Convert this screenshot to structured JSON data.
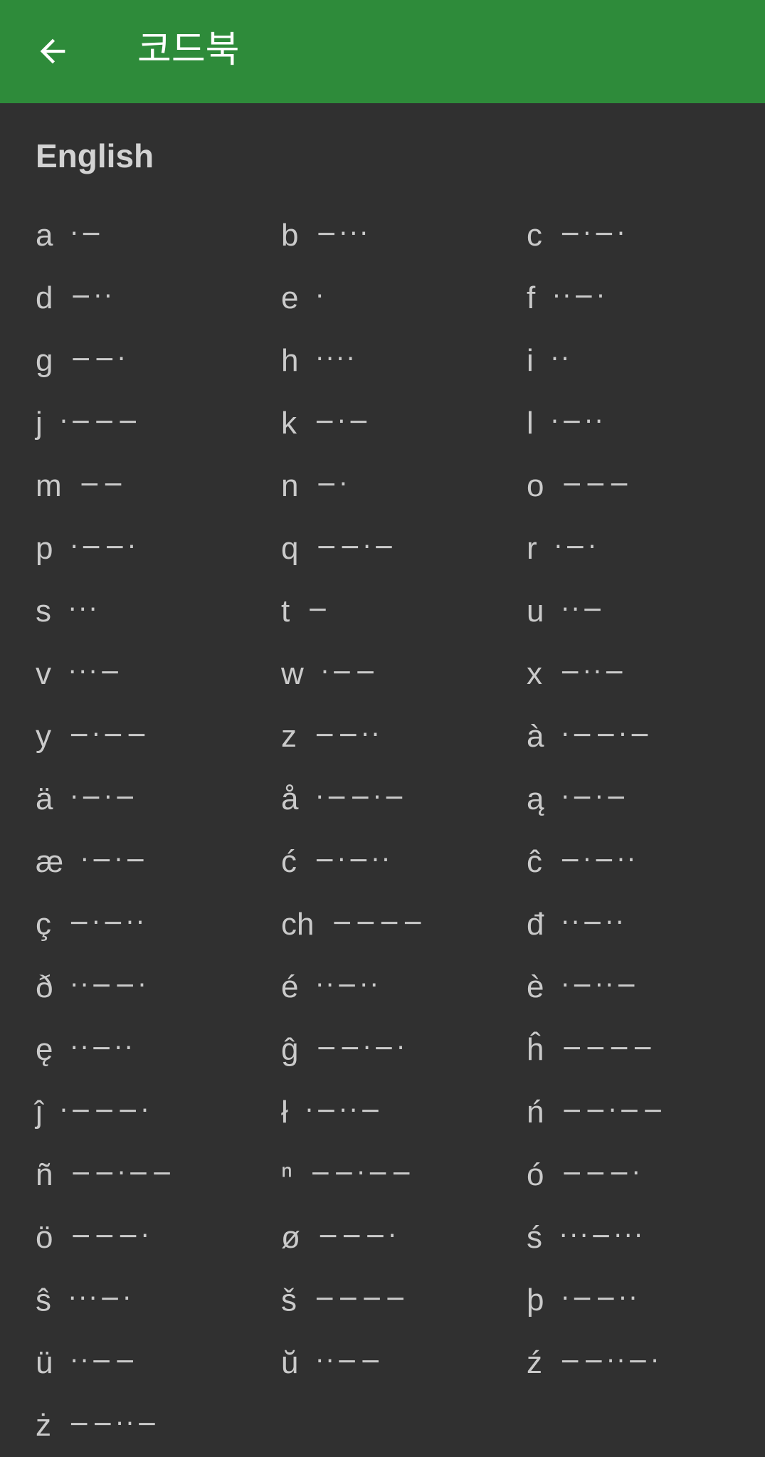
{
  "appbar": {
    "title": "코드북",
    "back_icon": "arrow-left-icon",
    "color": "#2e8b3a"
  },
  "section": {
    "title": "English"
  },
  "codes": [
    {
      "letter": "a",
      "code": "·−"
    },
    {
      "letter": "b",
      "code": "−···"
    },
    {
      "letter": "c",
      "code": "−·−·"
    },
    {
      "letter": "d",
      "code": "−··"
    },
    {
      "letter": "e",
      "code": "·"
    },
    {
      "letter": "f",
      "code": "··−·"
    },
    {
      "letter": "g",
      "code": "−−·"
    },
    {
      "letter": "h",
      "code": "····"
    },
    {
      "letter": "i",
      "code": "··"
    },
    {
      "letter": "j",
      "code": "·−−−"
    },
    {
      "letter": "k",
      "code": "−·−"
    },
    {
      "letter": "l",
      "code": "·−··"
    },
    {
      "letter": "m",
      "code": "−−"
    },
    {
      "letter": "n",
      "code": "−·"
    },
    {
      "letter": "o",
      "code": "−−−"
    },
    {
      "letter": "p",
      "code": "·−−·"
    },
    {
      "letter": "q",
      "code": "−−·−"
    },
    {
      "letter": "r",
      "code": "·−·"
    },
    {
      "letter": "s",
      "code": "···"
    },
    {
      "letter": "t",
      "code": "−"
    },
    {
      "letter": "u",
      "code": "··−"
    },
    {
      "letter": "v",
      "code": "···−"
    },
    {
      "letter": "w",
      "code": "·−−"
    },
    {
      "letter": "x",
      "code": "−··−"
    },
    {
      "letter": "y",
      "code": "−·−−"
    },
    {
      "letter": "z",
      "code": "−−··"
    },
    {
      "letter": "à",
      "code": "·−−·−"
    },
    {
      "letter": "ä",
      "code": "·−·−"
    },
    {
      "letter": "å",
      "code": "·−−·−"
    },
    {
      "letter": "ą",
      "code": "·−·−"
    },
    {
      "letter": "æ",
      "code": "·−·−"
    },
    {
      "letter": "ć",
      "code": "−·−··"
    },
    {
      "letter": "ĉ",
      "code": "−·−··"
    },
    {
      "letter": "ç",
      "code": "−·−··"
    },
    {
      "letter": "ch",
      "code": "−−−−"
    },
    {
      "letter": "đ",
      "code": "··−··"
    },
    {
      "letter": "ð",
      "code": "··−−·"
    },
    {
      "letter": "é",
      "code": "··−··"
    },
    {
      "letter": "è",
      "code": "·−··−"
    },
    {
      "letter": "ę",
      "code": "··−··"
    },
    {
      "letter": "ĝ",
      "code": "−−·−·"
    },
    {
      "letter": "ĥ",
      "code": "−−−−"
    },
    {
      "letter": "ĵ",
      "code": "·−−−·"
    },
    {
      "letter": "ł",
      "code": "·−··−"
    },
    {
      "letter": "ń",
      "code": "−−·−−"
    },
    {
      "letter": "ñ",
      "code": "−−·−−"
    },
    {
      "letter": "ⁿ",
      "code": "−−·−−"
    },
    {
      "letter": "ó",
      "code": "−−−·"
    },
    {
      "letter": "ö",
      "code": "−−−·"
    },
    {
      "letter": "ø",
      "code": "−−−·"
    },
    {
      "letter": "ś",
      "code": "···−···"
    },
    {
      "letter": "ŝ",
      "code": "···−·"
    },
    {
      "letter": "š",
      "code": "−−−−"
    },
    {
      "letter": "þ",
      "code": "·−−··"
    },
    {
      "letter": "ü",
      "code": "··−−"
    },
    {
      "letter": "ŭ",
      "code": "··−−"
    },
    {
      "letter": "ź",
      "code": "−−··−·"
    },
    {
      "letter": "ż",
      "code": "−−··−"
    }
  ]
}
